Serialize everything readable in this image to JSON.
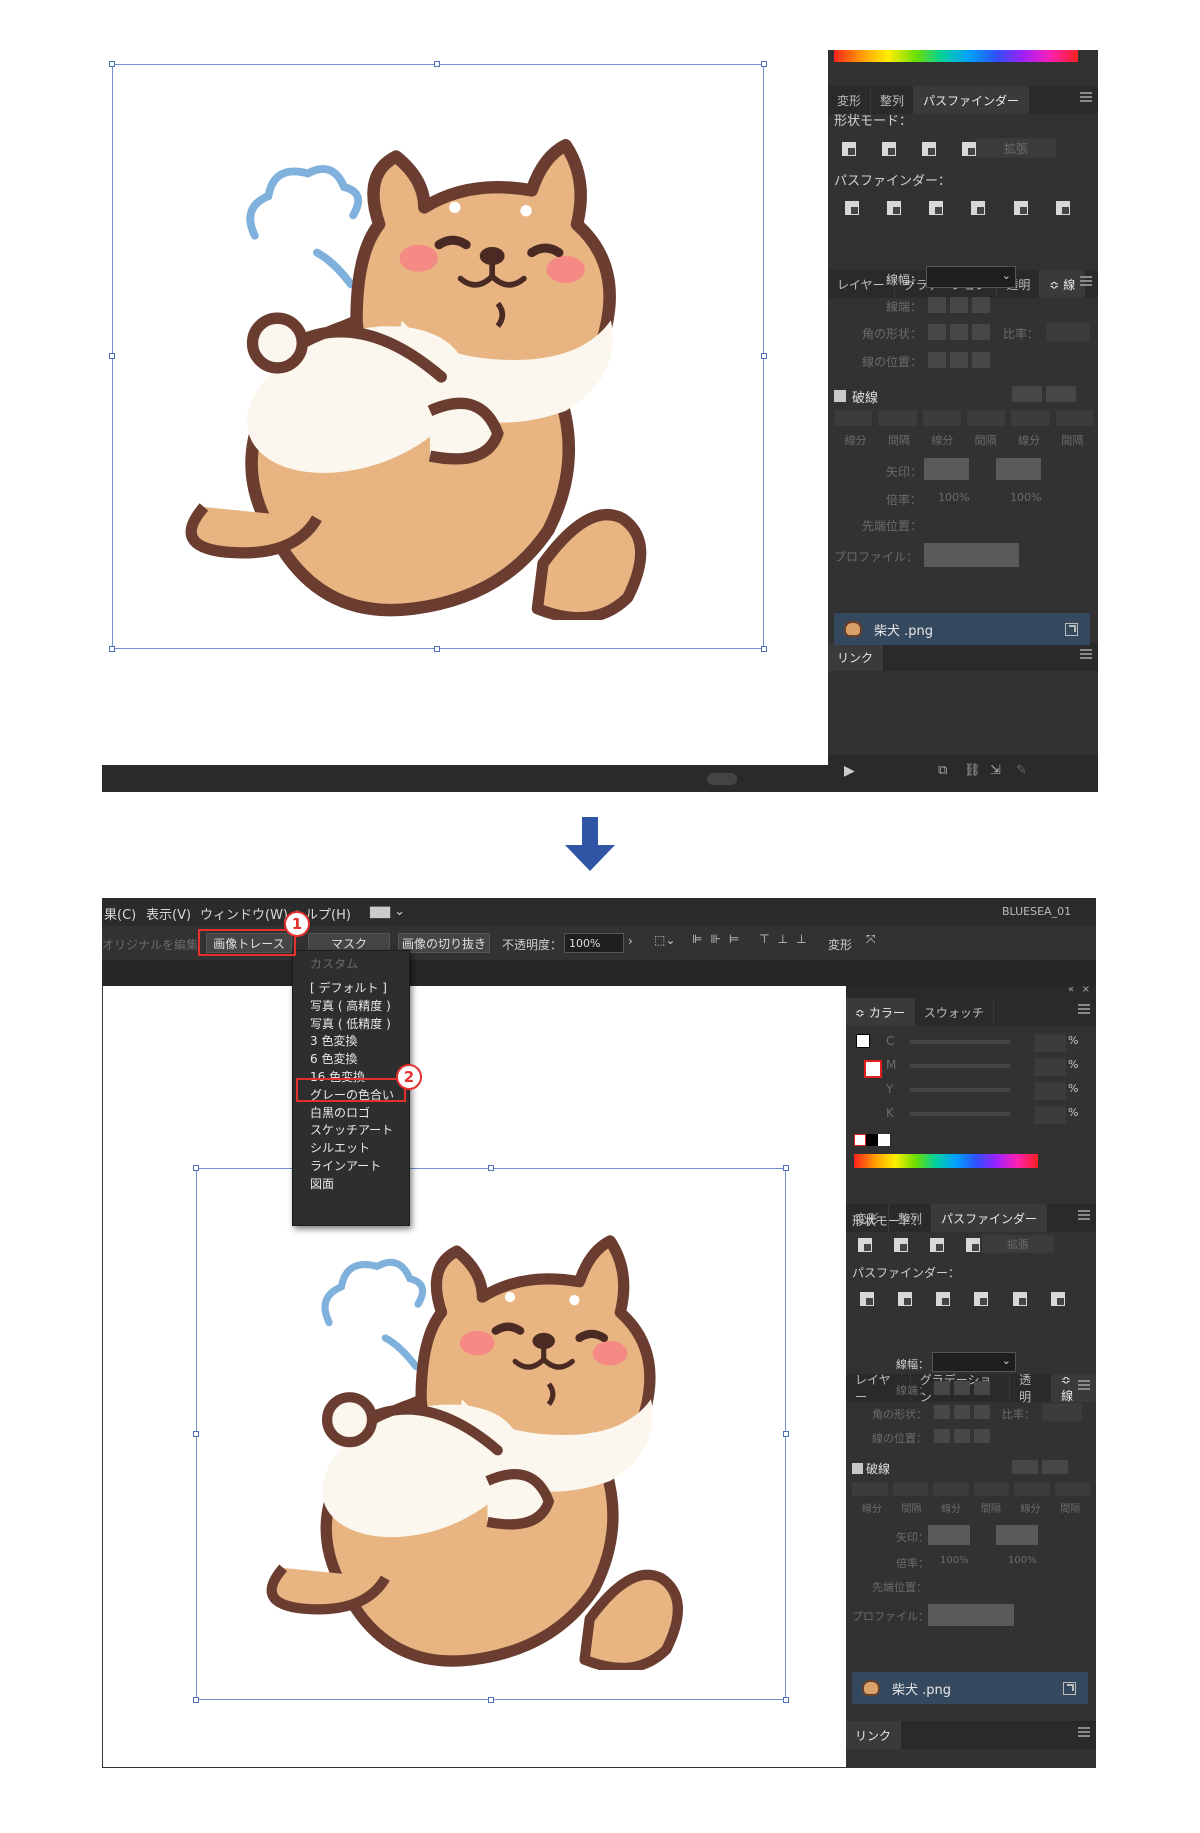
{
  "panels": {
    "tabs1": [
      "変形",
      "整列",
      "パスファインダー"
    ],
    "shape_mode_label": "形状モード：",
    "expand_button": "拡張",
    "pathfinder_label": "パスファインダー：",
    "tabs2": [
      "レイヤー",
      "グラデーション",
      "透明",
      "≎ 線"
    ],
    "stroke_weight_label": "線幅：",
    "cap_label": "線端：",
    "corner_label": "角の形状：",
    "ratio_label": "比率：",
    "align_label": "線の位置：",
    "dashed_label": "破線",
    "dash_cols": [
      "線分",
      "間隔",
      "線分",
      "間隔",
      "線分",
      "間隔"
    ],
    "arrow_label": "矢印：",
    "scale_label": "倍率：",
    "scale_value": "100%",
    "tip_label": "先端位置：",
    "profile_label": "プロファイル：",
    "links_tab": "リンク",
    "link_file": "柴犬 .png",
    "color_tabs": [
      "≎ カラー",
      "スウォッチ"
    ],
    "cmyk": [
      "C",
      "M",
      "Y",
      "K"
    ],
    "percent": "%"
  },
  "bottom": {
    "menubar": [
      "果(C)",
      "表示(V)",
      "ウィンドウ(W)",
      "ヘルプ(H)"
    ],
    "workspace": "BLUESEA_01",
    "toolbar": {
      "edit_original": "オリジナルを編集",
      "image_trace": "画像トレース",
      "mask": "マスク",
      "crop": "画像の切り抜き",
      "opacity_label": "不透明度：",
      "opacity_value": "100%",
      "transform": "変形"
    },
    "dropdown": {
      "custom": "カスタム",
      "items": [
        "[ デフォルト ]",
        "写真 ( 高精度 )",
        "写真 ( 低精度 )",
        "3 色変換",
        "6 色変換",
        "16 色変換",
        "グレーの色合い",
        "白黒のロゴ",
        "スケッチアート",
        "シルエット",
        "ラインアート",
        "図面"
      ]
    },
    "callouts": [
      "1",
      "2"
    ]
  },
  "colors": {
    "arrow": "#2f55a4",
    "callout": "#e53030",
    "link_row": "#34495e",
    "panel": "#323232"
  }
}
